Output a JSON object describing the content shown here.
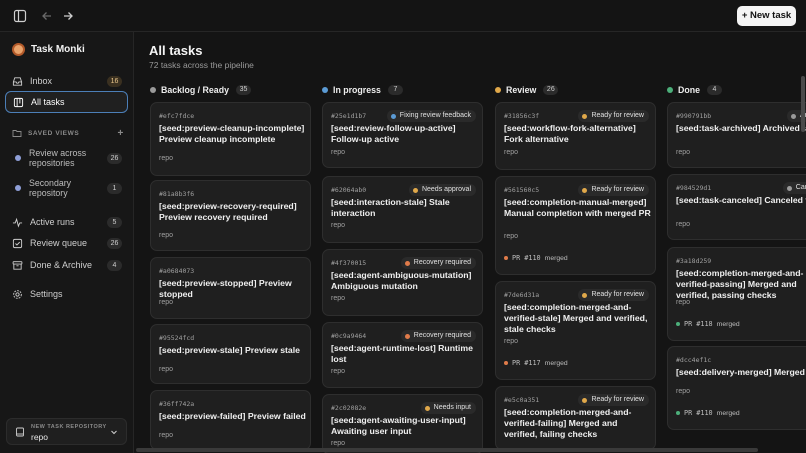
{
  "toolbar": {
    "new_task_label": "+ New task"
  },
  "brand": {
    "name": "Task Monki"
  },
  "sidebar": {
    "nav": [
      {
        "label": "Inbox",
        "count": "16",
        "icon": "inbox-icon"
      },
      {
        "label": "All tasks",
        "icon": "board-icon"
      }
    ],
    "saved_views_label": "SAVED VIEWS",
    "saved_views": [
      {
        "label": "Review across repositories",
        "count": "26"
      },
      {
        "label": "Secondary repository",
        "count": "1"
      }
    ],
    "queues": [
      {
        "label": "Active runs",
        "count": "5",
        "icon": "activity-icon"
      },
      {
        "label": "Review queue",
        "count": "26",
        "icon": "check-square-icon"
      },
      {
        "label": "Done & Archive",
        "count": "4",
        "icon": "archive-icon"
      },
      {
        "label": "Settings",
        "icon": "gear-icon"
      }
    ],
    "repo_picker": {
      "caption": "NEW TASK REPOSITORY",
      "value": "repo"
    }
  },
  "main": {
    "title": "All tasks",
    "subtitle": "72 tasks across the pipeline",
    "columns": [
      {
        "name": "Backlog / Ready",
        "count": "35",
        "color": "#9a9a9a",
        "cards": [
          {
            "id": "#efc7fdce",
            "title": "[seed:preview-cleanup-incomplete] Preview cleanup incomplete",
            "repo": "repo"
          },
          {
            "id": "#81a8b3f6",
            "title": "[seed:preview-recovery-required] Preview recovery required",
            "repo": "repo"
          },
          {
            "id": "#a0684073",
            "title": "[seed:preview-stopped] Preview stopped",
            "repo": "repo"
          },
          {
            "id": "#95524fcd",
            "title": "[seed:preview-stale] Preview stale",
            "repo": "repo"
          },
          {
            "id": "#36ff742a",
            "title": "[seed:preview-failed] Preview failed",
            "repo": "repo"
          }
        ]
      },
      {
        "name": "In progress",
        "count": "7",
        "color": "#5b9bd5",
        "cards": [
          {
            "id": "#25e1d1b7",
            "badge": "Fixing review feedback",
            "badge_color": "#5b9bd5",
            "title": "[seed:review-follow-up-active] Follow-up active",
            "repo": "repo"
          },
          {
            "id": "#62064ab0",
            "badge": "Needs approval",
            "badge_color": "#e0a84a",
            "title": "[seed:interaction-stale] Stale interaction",
            "repo": "repo"
          },
          {
            "id": "#4f370015",
            "badge": "Recovery required",
            "badge_color": "#e07b4a",
            "title": "[seed:agent-ambiguous-mutation] Ambiguous mutation",
            "repo": "repo"
          },
          {
            "id": "#0c9a9464",
            "badge": "Recovery required",
            "badge_color": "#e07b4a",
            "title": "[seed:agent-runtime-lost] Runtime lost",
            "repo": "repo"
          },
          {
            "id": "#2c02082e",
            "badge": "Needs input",
            "badge_color": "#e0a84a",
            "title": "[seed:agent-awaiting-user-input] Awaiting user input",
            "repo": "repo"
          }
        ]
      },
      {
        "name": "Review",
        "count": "26",
        "color": "#e0a84a",
        "cards": [
          {
            "id": "#31856c3f",
            "badge": "Ready for review",
            "badge_color": "#e0a84a",
            "title": "[seed:workflow-fork-alternative] Fork alternative",
            "repo": "repo"
          },
          {
            "id": "#561560c5",
            "badge": "Ready for review",
            "badge_color": "#e0a84a",
            "title": "[seed:completion-manual-merged] Manual completion with merged PR",
            "repo": "repo",
            "pr": "PR #110",
            "pr_status": "merged",
            "pr_color": "#e07b4a"
          },
          {
            "id": "#7de6d31a",
            "badge": "Ready for review",
            "badge_color": "#e0a84a",
            "title": "[seed:completion-merged-and-verified-stale] Merged and verified, stale checks",
            "repo": "repo",
            "pr": "PR #117",
            "pr_status": "merged",
            "pr_color": "#e07b4a"
          },
          {
            "id": "#e5c0a351",
            "badge": "Ready for review",
            "badge_color": "#e0a84a",
            "title": "[seed:completion-merged-and-verified-failing] Merged and verified, failing checks",
            "repo": "repo"
          }
        ]
      },
      {
        "name": "Done",
        "count": "4",
        "color": "#4caf7a",
        "cards": [
          {
            "id": "#990791bb",
            "badge": "Archi",
            "badge_color": "#9a9a9a",
            "title": "[seed:task-archived] Archived task",
            "repo": "repo"
          },
          {
            "id": "#984529d1",
            "badge": "Cance",
            "badge_color": "#9a9a9a",
            "title": "[seed:task-canceled] Canceled task",
            "repo": "repo"
          },
          {
            "id": "#3a18d259",
            "title": "[seed:completion-merged-and-verified-passing] Merged and verified, passing checks",
            "repo": "repo",
            "pr": "PR #118",
            "pr_status": "merged",
            "pr_color": "#4caf7a"
          },
          {
            "id": "#dcc4ef1c",
            "title": "[seed:delivery-merged] Merged PR",
            "repo": "repo",
            "pr": "PR #110",
            "pr_status": "merged",
            "pr_color": "#4caf7a"
          }
        ]
      }
    ]
  }
}
